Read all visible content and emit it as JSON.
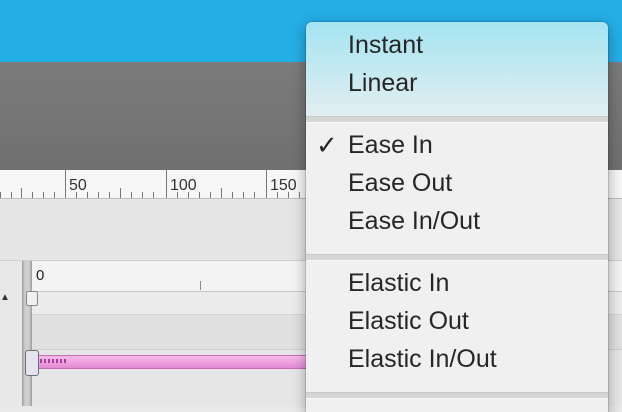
{
  "ruler": {
    "labels": [
      "50",
      "100",
      "150"
    ]
  },
  "timeline": {
    "zero_label": "0"
  },
  "menu": {
    "items": [
      {
        "label": "Instant",
        "checked": false
      },
      {
        "label": "Linear",
        "checked": false
      },
      {
        "label": "Ease In",
        "checked": true
      },
      {
        "label": "Ease Out",
        "checked": false
      },
      {
        "label": "Ease In/Out",
        "checked": false
      },
      {
        "label": "Elastic In",
        "checked": false
      },
      {
        "label": "Elastic Out",
        "checked": false
      },
      {
        "label": "Elastic In/Out",
        "checked": false
      }
    ],
    "check_glyph": "✓"
  },
  "colors": {
    "accent_blue": "#24aee6",
    "tween_pink": "#e58ad4",
    "menu_highlight": "#a4e4f1"
  }
}
